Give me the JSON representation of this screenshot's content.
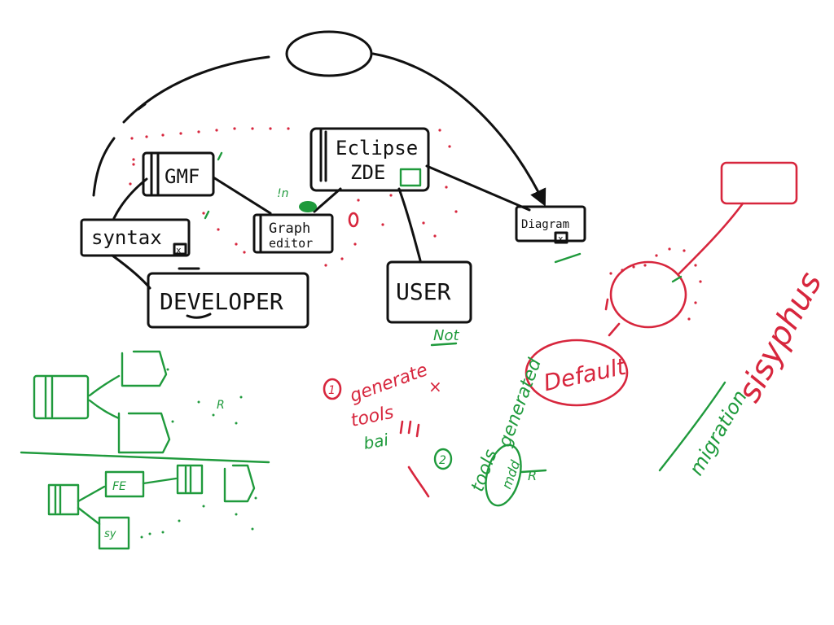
{
  "canvas": {
    "background": "#ffffff"
  },
  "colors": {
    "black": "#111111",
    "red": "#d7263d",
    "green": "#1f9a3c"
  },
  "nodes": {
    "gmf": "GMF",
    "eclipse": "Eclipse",
    "zde": "ZDE",
    "syntax": "syntax",
    "graph": "Graph",
    "editor": "editor",
    "diagram": "Diagram",
    "developer": "DEVELOPER",
    "user": "USER",
    "default": "Default"
  },
  "annotations": {
    "step1_marker": "1",
    "generate": "generate",
    "not": "Not",
    "tools_1": "tools",
    "bai": "bai",
    "step2_marker": "2",
    "generated": "generated",
    "tools_2": "tools",
    "mdd": "mdd",
    "sisyphus": "sisyphus",
    "migration": "migration",
    "green_mark_top": "!n",
    "green_fe": "FE",
    "green_sy": "sy",
    "green_r1": "R",
    "green_r2": "R",
    "box_x": "x"
  }
}
